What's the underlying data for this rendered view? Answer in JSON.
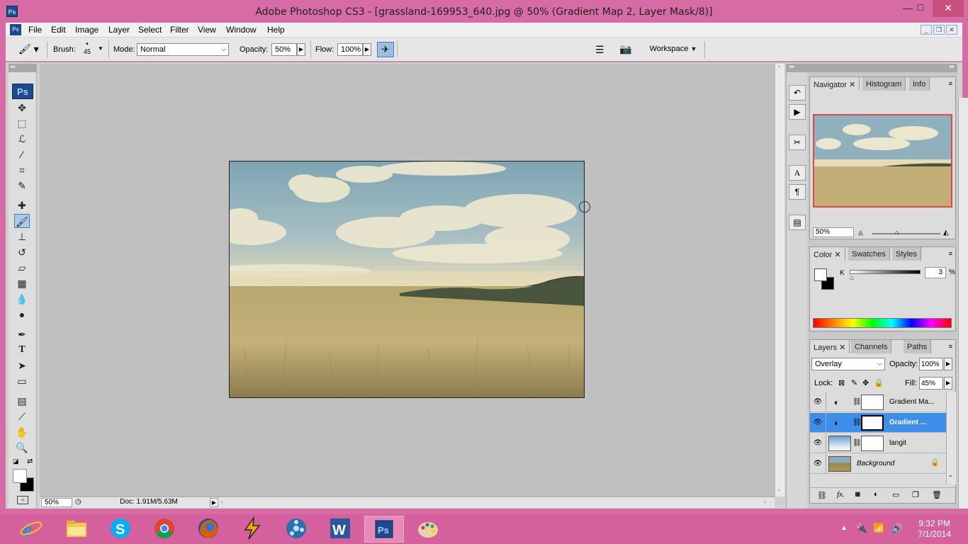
{
  "window": {
    "title": "Adobe Photoshop CS3 - [grassland-169953_640.jpg @ 50% (Gradient Map 2, Layer Mask/8)]",
    "minimize": "—",
    "maximize": "☐",
    "close": "✕"
  },
  "menu": {
    "items": [
      "File",
      "Edit",
      "Image",
      "Layer",
      "Select",
      "Filter",
      "View",
      "Window",
      "Help"
    ]
  },
  "options": {
    "brush_label": "Brush:",
    "brush_size": "45",
    "mode_label": "Mode:",
    "mode_value": "Normal",
    "opacity_label": "Opacity:",
    "opacity_value": "50%",
    "flow_label": "Flow:",
    "flow_value": "100%",
    "workspace_label": "Workspace"
  },
  "toolbox": {
    "logo": "Ps"
  },
  "status": {
    "zoom": "50%",
    "doc": "Doc: 1.91M/5.63M"
  },
  "navigator": {
    "tabs": [
      "Navigator",
      "Histogram",
      "Info"
    ],
    "zoom": "50%"
  },
  "color_panel": {
    "tabs": [
      "Color",
      "Swatches",
      "Styles"
    ],
    "channel_label": "K",
    "channel_value": "3",
    "unit": "%"
  },
  "layers_panel": {
    "tabs": [
      "Layers",
      "Channels",
      "Paths"
    ],
    "blend_mode": "Overlay",
    "opacity_label": "Opacity:",
    "opacity_value": "100%",
    "lock_label": "Lock:",
    "fill_label": "Fill:",
    "fill_value": "45%",
    "layers": [
      {
        "name": "Gradient Ma...",
        "selected": false
      },
      {
        "name": "Gradient ...",
        "selected": true
      },
      {
        "name": "langit",
        "selected": false
      },
      {
        "name": "Background",
        "selected": false
      }
    ]
  },
  "taskbar": {
    "time": "9:32 PM",
    "date": "7/1/2014"
  },
  "colors": {
    "accent": "#3d8ee8",
    "taskbar": "#d4619d",
    "window_frame": "#d76ca5"
  }
}
